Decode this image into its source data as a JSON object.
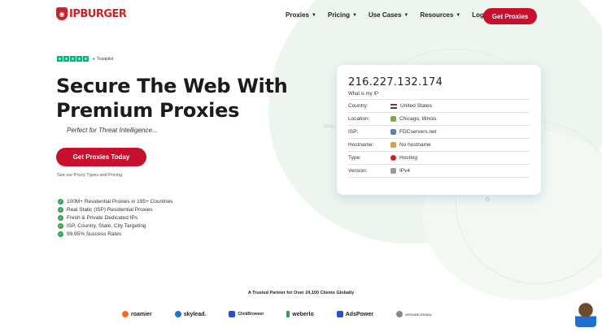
{
  "brand": {
    "name": "IPBURGER",
    "color": "#d0202a"
  },
  "nav": {
    "items": [
      {
        "label": "Proxies",
        "icon": "chevron-down-icon"
      },
      {
        "label": "Pricing",
        "icon": "chevron-down-icon"
      },
      {
        "label": "Use Cases",
        "icon": "chevron-down-icon"
      },
      {
        "label": "Resources",
        "icon": "chevron-down-icon"
      }
    ],
    "login": "Login",
    "cta": "Get Proxies"
  },
  "hero": {
    "trust_label": "Trustpilot",
    "title": "Secure The Web With Premium Proxies",
    "subtitle": "Perfect for Threat Intelligence...",
    "cta": "Get Proxies Today",
    "see_link": "See our Proxy Types and Pricing",
    "features": [
      "100M+ Residential Proxies in 195+ Countries",
      "Real Static (ISP) Residential Proxies",
      "Fresh & Private Dedicated IPs",
      "ISP, Country, State, City Targeting",
      "99.95% Success Rates"
    ]
  },
  "ip_card": {
    "ip": "216.227.132.174",
    "what": "What is my IP",
    "rows": [
      {
        "key": "Country:",
        "value": "United States",
        "icon": "us-flag-icon"
      },
      {
        "key": "Location:",
        "value": "Chicago, Illinois",
        "icon": "location-icon"
      },
      {
        "key": "ISP:",
        "value": "FDCservers.net",
        "icon": "server-icon"
      },
      {
        "key": "Hostname:",
        "value": "No hostname",
        "icon": "hostname-icon"
      },
      {
        "key": "Type:",
        "value": "Hosting",
        "icon": "hosting-icon"
      },
      {
        "key": "Version:",
        "value": "IPv4",
        "icon": "version-icon"
      }
    ]
  },
  "background_marks": {
    "left": "ebay"
  },
  "partners": {
    "heading": "A Trusted Partner for Over 24,100 Clients Globally",
    "items": [
      {
        "name": "roamier",
        "color": "#f26b21"
      },
      {
        "name": "skylead.",
        "color": "#1f6fd0"
      },
      {
        "name": "ClickBrowser",
        "color": "#2b4bd8"
      },
      {
        "name": "weberlo",
        "color": "#2ea44f"
      },
      {
        "name": "AdsPower",
        "color": "#2b4bd8"
      },
      {
        "name": "GROUND ESSIAL",
        "color": "#888888"
      }
    ]
  }
}
